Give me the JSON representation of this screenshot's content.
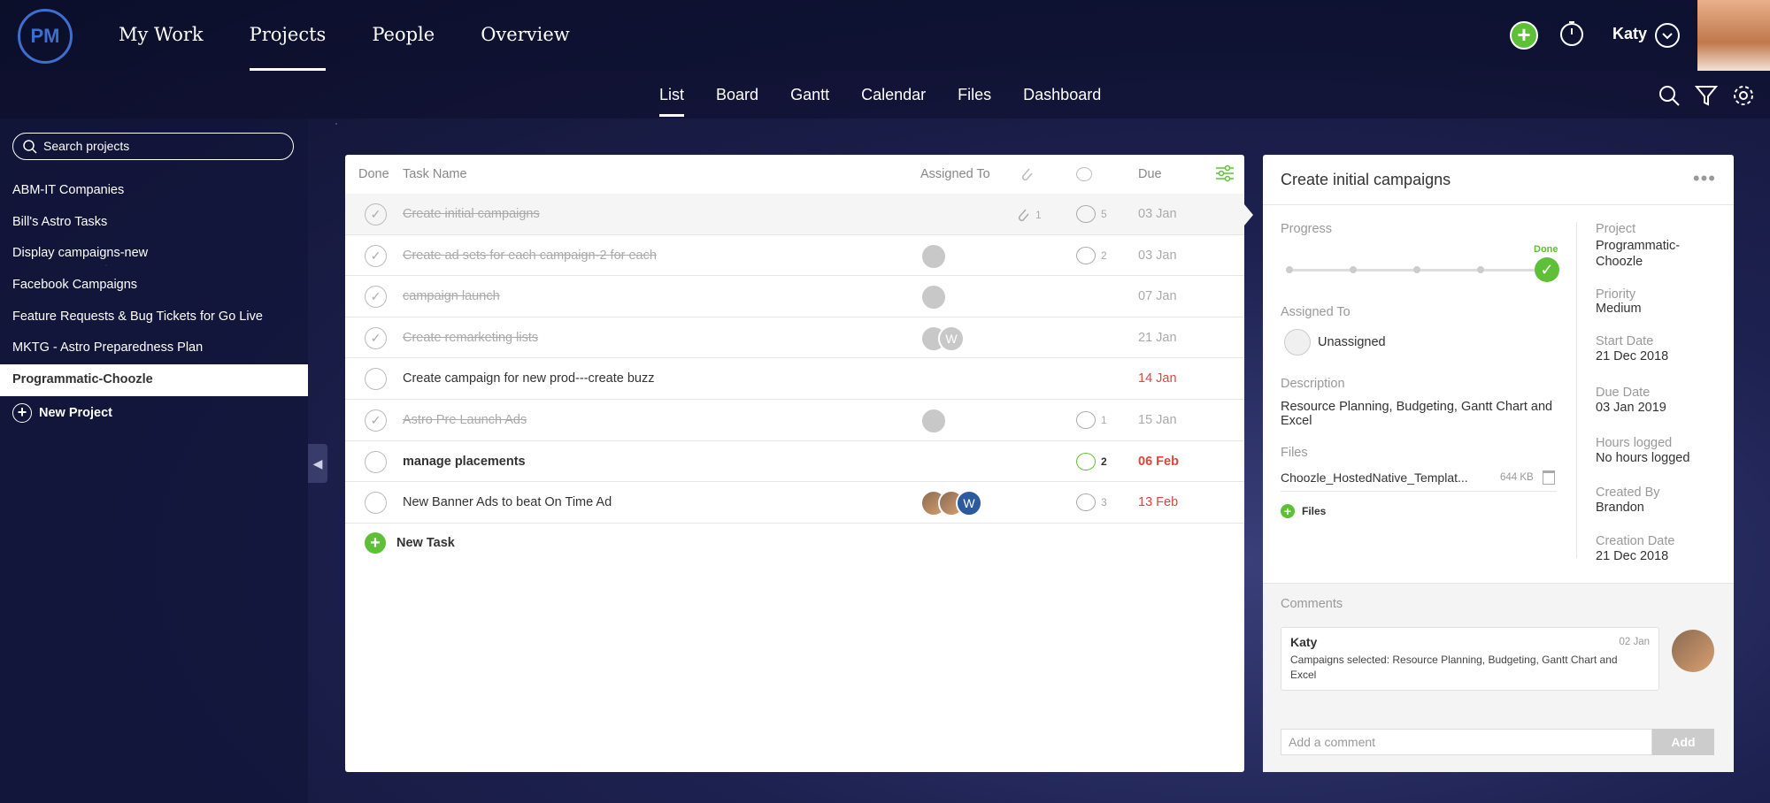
{
  "brand": {
    "logo_text": "PM"
  },
  "main_nav": [
    {
      "label": "My Work",
      "active": false
    },
    {
      "label": "Projects",
      "active": true
    },
    {
      "label": "People",
      "active": false
    },
    {
      "label": "Overview",
      "active": false
    }
  ],
  "user": {
    "name": "Katy"
  },
  "sub_nav": [
    {
      "label": "List",
      "active": true
    },
    {
      "label": "Board",
      "active": false
    },
    {
      "label": "Gantt",
      "active": false
    },
    {
      "label": "Calendar",
      "active": false
    },
    {
      "label": "Files",
      "active": false
    },
    {
      "label": "Dashboard",
      "active": false
    }
  ],
  "sidebar": {
    "search_placeholder": "Search projects",
    "projects": [
      "ABM-IT Companies",
      "Bill's Astro Tasks",
      "Display campaigns-new",
      "Facebook Campaigns",
      "Feature Requests & Bug Tickets for Go Live",
      "MKTG - Astro Preparedness Plan",
      "Programmatic-Choozle"
    ],
    "active_project": "Programmatic-Choozle",
    "new_project_label": "New Project"
  },
  "task_table": {
    "headers": {
      "done": "Done",
      "task_name": "Task Name",
      "assigned_to": "Assigned To",
      "due": "Due"
    },
    "rows": [
      {
        "name": "Create initial campaigns",
        "done": true,
        "attachments": "1",
        "comments": "5",
        "due": "03 Jan",
        "assignees": []
      },
      {
        "name": "Create ad sets for each campaign-2 for each",
        "done": true,
        "attachments": "",
        "comments": "2",
        "due": "03 Jan",
        "assignees": [
          "grey"
        ]
      },
      {
        "name": "campaign launch",
        "done": true,
        "attachments": "",
        "comments": "",
        "due": "07 Jan",
        "assignees": [
          "grey"
        ]
      },
      {
        "name": "Create remarketing lists",
        "done": true,
        "attachments": "",
        "comments": "",
        "due": "21 Jan",
        "assignees": [
          "grey",
          "W"
        ]
      },
      {
        "name": "Create campaign for new prod---create buzz",
        "done": false,
        "attachments": "",
        "comments": "",
        "due": "14 Jan",
        "assignees": []
      },
      {
        "name": "Astro Pre Launch Ads",
        "done": true,
        "attachments": "",
        "comments": "1",
        "due": "15 Jan",
        "assignees": [
          "grey"
        ]
      },
      {
        "name": "manage placements",
        "done": false,
        "attachments": "",
        "comments": "2",
        "due": "06 Feb",
        "assignees": []
      },
      {
        "name": "New Banner Ads to beat On Time Ad",
        "done": false,
        "attachments": "",
        "comments": "3",
        "due": "13 Feb",
        "assignees": [
          "photo",
          "photo",
          "W"
        ]
      }
    ],
    "new_task_label": "New Task"
  },
  "detail": {
    "title": "Create initial campaigns",
    "progress_label": "Progress",
    "progress_status": "Done",
    "progress_value": 1.0,
    "assigned_to_label": "Assigned To",
    "assigned_to_value": "Unassigned",
    "description_label": "Description",
    "description_value": "Resource Planning, Budgeting, Gantt Chart and Excel",
    "files_label": "Files",
    "file_name": "Choozle_HostedNative_Templat...",
    "file_size": "644 KB",
    "files_add_label": "Files",
    "meta": [
      {
        "label": "Project",
        "value": "Programmatic-Choozle"
      },
      {
        "label": "Priority",
        "value": "Medium"
      },
      {
        "label": "Start Date",
        "value": "21 Dec 2018"
      },
      {
        "label": "Due Date",
        "value": "03 Jan 2019"
      },
      {
        "label": "Hours logged",
        "value": "No hours logged"
      },
      {
        "label": "Created By",
        "value": "Brandon"
      },
      {
        "label": "Creation Date",
        "value": "21 Dec 2018"
      }
    ],
    "comments_label": "Comments",
    "comment": {
      "author": "Katy",
      "date": "02 Jan",
      "text": "Campaigns selected: Resource Planning, Budgeting, Gantt Chart and Excel"
    },
    "comment_placeholder": "Add a comment",
    "add_button": "Add"
  },
  "colors": {
    "accent_green": "#5ec037",
    "overdue_red": "#e0463c",
    "logo_blue": "#3c6fd0"
  }
}
